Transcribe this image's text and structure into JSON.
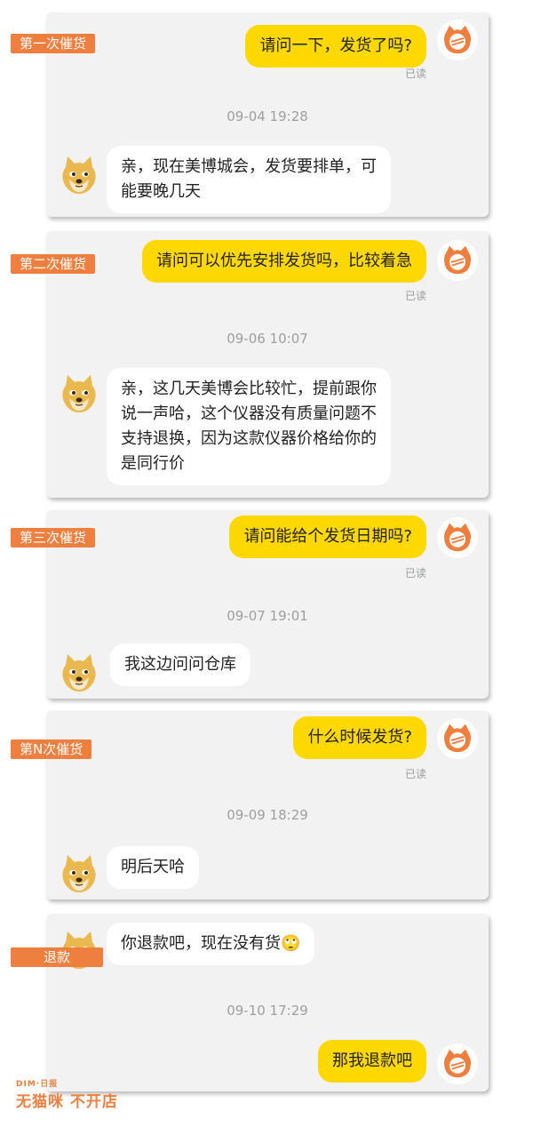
{
  "colors": {
    "accent": "#ef7f3f",
    "my_bubble": "#ffd800",
    "card": "#f2f2f2"
  },
  "icons": {
    "me_avatar": "cat-logo-icon",
    "shop_avatar": "doge-avatar-icon"
  },
  "sections": [
    {
      "tag": "第一次催货",
      "my_msg": "请问一下，发货了吗?",
      "read": "已读",
      "time": "09-04 19:28",
      "reply": [
        "亲，现在美博城会，发货要排单，可",
        "能要晚几天"
      ]
    },
    {
      "tag": "第二次催货",
      "my_msg": "请问可以优先安排发货吗，比较着急",
      "read": "已读",
      "time": "09-06 10:07",
      "reply": [
        "亲，这几天美博会比较忙，提前跟你",
        "说一声哈，这个仪器没有质量问题不",
        "支持退换，因为这款仪器价格给你的",
        "是同行价"
      ]
    },
    {
      "tag": "第三次催货",
      "my_msg": "请问能给个发货日期吗?",
      "read": "已读",
      "time": "09-07 19:01",
      "reply": [
        "我这边问问仓库"
      ]
    },
    {
      "tag": "第N次催货",
      "my_msg": "什么时候发货?",
      "read": "已读",
      "time": "09-09 18:29",
      "reply": [
        "明后天哈"
      ]
    },
    {
      "tag": "退款",
      "shop_msg": "你退款吧，现在没有货",
      "shop_emoji": "🙄",
      "time": "09-10 17:29",
      "my_msg": "那我退款吧"
    }
  ],
  "logo": {
    "top": "DIM·日报",
    "main": "无猫咪 不开店"
  }
}
